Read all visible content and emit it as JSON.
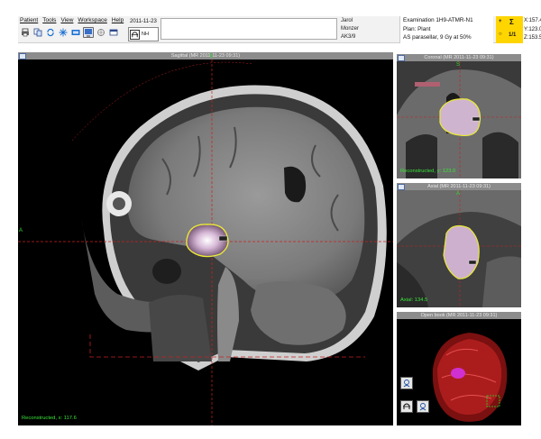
{
  "menu": [
    "Patient",
    "Tools",
    "View",
    "Workspace",
    "Help"
  ],
  "toolbar": {
    "icons": [
      "print-icon",
      "copy-icon",
      "sync-icon",
      "snowflake-icon",
      "layout-icon",
      "screen-icon",
      "target-icon",
      "window-icon"
    ],
    "date": "2011-11-23",
    "session_label": "NH"
  },
  "patient": {
    "first_name": "Jarol",
    "last_name": "Monzer",
    "id": "AK3/9"
  },
  "plan": {
    "examination": "Examination 1H9-ATMR-N1",
    "plan_name": "Plan: Plant",
    "prescription": "AS parasellar, 9 Gy at 50%"
  },
  "dose_panel": {
    "color": "#ffd500",
    "top_left": "+",
    "top_right": "Σ",
    "bottom_left": "○",
    "bottom_right": "1/1"
  },
  "coordinates": {
    "x": "X:157.4",
    "y": "Y:123.0",
    "z": "Z:153.5"
  },
  "viewports": {
    "sagittal": {
      "title": "Sagittal (MR 2011-11-23 09:31)",
      "status": "Reconstructed, x: 117.6",
      "label_top": "S",
      "label_left": "A"
    },
    "coronal": {
      "title": "Coronal (MR 2011-11-23 09:31)",
      "status": "Reconstructed, y: 123.0",
      "label_top": "S"
    },
    "axial": {
      "title": "Axial (MR 2011-11-23 09:31)",
      "status": "Axial: 134.5",
      "label_top": "A"
    },
    "view3d": {
      "title": "Open book (MR 2011-11-23 09:31)"
    }
  },
  "colors": {
    "tumor_contour": "#e8e838",
    "crosshair": "#c82020",
    "status_text": "#39e639",
    "title_bar": "#8c8c8c"
  }
}
